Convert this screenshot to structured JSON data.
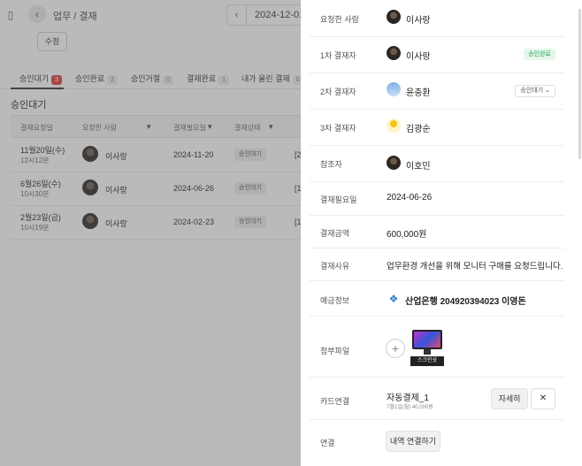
{
  "topbar": {
    "breadcrumb": "업무 / 결재",
    "date": "2024-12-01",
    "edit_label": "수정"
  },
  "tabs": [
    {
      "label": "승인대기",
      "count": "3"
    },
    {
      "label": "승인완료",
      "count": "2"
    },
    {
      "label": "승인거절",
      "count": "0"
    },
    {
      "label": "결재완료",
      "count": "1"
    },
    {
      "label": "내가 올린 결재",
      "count": "0"
    }
  ],
  "section_title": "승인대기",
  "table": {
    "headers": [
      "결재요청일",
      "요청한 사람",
      "결재필요일",
      "결재상태"
    ],
    "rows": [
      {
        "date": "11월20일(수)",
        "time": "12시12분",
        "requester": "이사랑",
        "due": "2024-11-20",
        "status": "승인대기",
        "extra": "[2"
      },
      {
        "date": "6월26일(수)",
        "time": "10시30분",
        "requester": "이사랑",
        "due": "2024-06-26",
        "status": "승인대기",
        "extra": "[1"
      },
      {
        "date": "2월23일(금)",
        "time": "10시19분",
        "requester": "이사랑",
        "due": "2024-02-23",
        "status": "승인대기",
        "extra": "[1"
      }
    ]
  },
  "detail": {
    "requester": {
      "label": "요청한 사람",
      "name": "이사랑"
    },
    "approver1": {
      "label": "1차 결재자",
      "name": "이사랑",
      "badge": "승인완료"
    },
    "approver2": {
      "label": "2차 결재자",
      "name": "윤충환",
      "badge": "승인대기"
    },
    "approver3": {
      "label": "3차 결재자",
      "name": "김광순"
    },
    "reference": {
      "label": "참조자",
      "name": "이호민"
    },
    "due": {
      "label": "결재필요일",
      "value": "2024-06-26"
    },
    "amount": {
      "label": "결재금액",
      "value": "600,000원"
    },
    "reason": {
      "label": "결재사유",
      "value": "업무환경 개선을 위해 모니터 구매를 요청드립니다."
    },
    "bank": {
      "label": "예금정보",
      "value": "산업은행 204920394023 이영돈"
    },
    "attachment": {
      "label": "첨부파일",
      "thumb_caption": "스크린샷"
    },
    "card": {
      "label": "카드연결",
      "title": "자동결제_1",
      "sub": "7월1일(월) 40,000원",
      "detail_button": "자세히"
    },
    "link": {
      "label": "연결",
      "button": "내역 연결하기"
    }
  }
}
